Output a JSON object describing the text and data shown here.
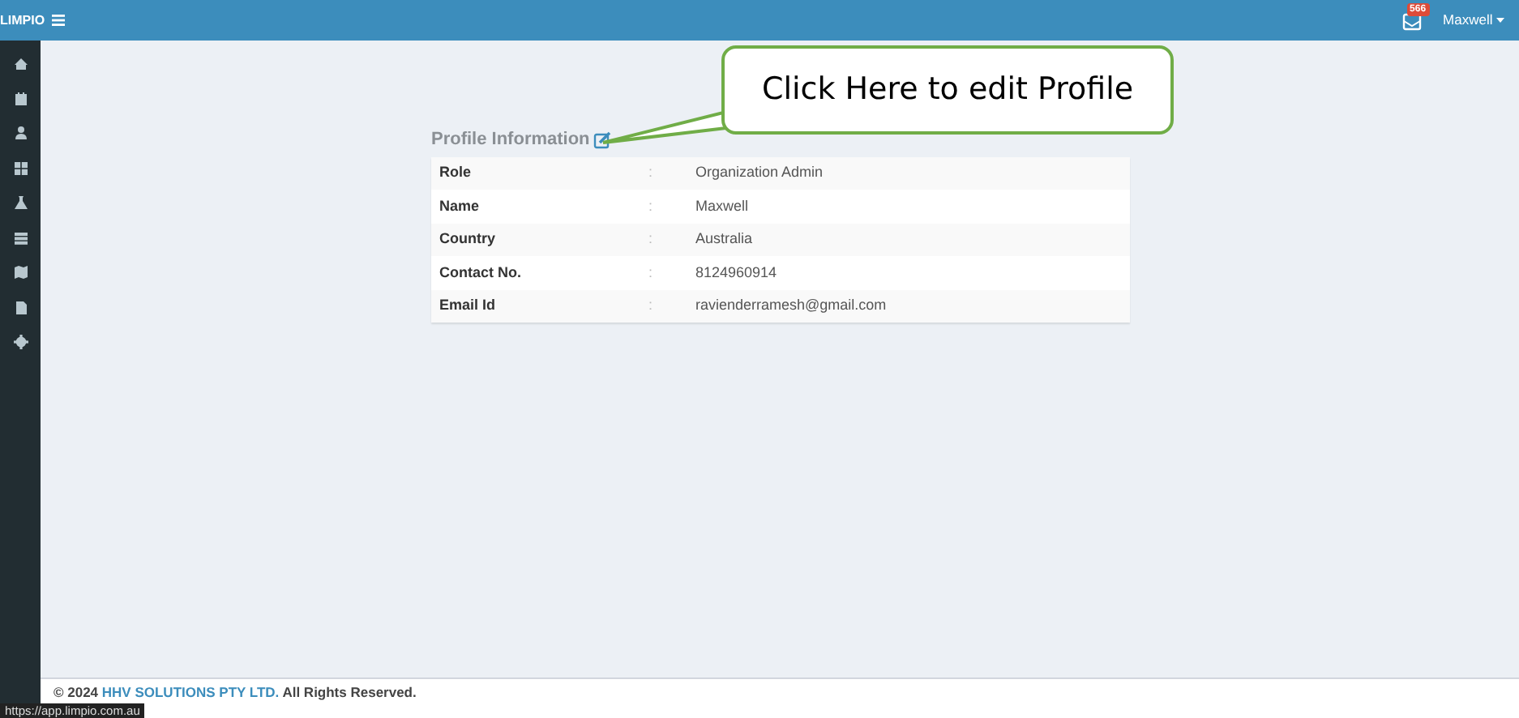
{
  "navbar": {
    "brand": "LIMPIO",
    "notification_count": "566",
    "user": "Maxwell"
  },
  "sidebar": {
    "items": [
      {
        "kind": "home"
      },
      {
        "kind": "calendar"
      },
      {
        "kind": "user"
      },
      {
        "kind": "grid"
      },
      {
        "kind": "flask"
      },
      {
        "kind": "list"
      },
      {
        "kind": "map"
      },
      {
        "kind": "file"
      },
      {
        "kind": "gear"
      }
    ]
  },
  "profile": {
    "title": "Profile Information",
    "separator": ":",
    "rows": [
      {
        "label": "Role",
        "value": "Organization Admin"
      },
      {
        "label": "Name",
        "value": "Maxwell"
      },
      {
        "label": "Country",
        "value": "Australia"
      },
      {
        "label": "Contact No.",
        "value": "8124960914"
      },
      {
        "label": "Email Id",
        "value": "ravienderramesh@gmail.com"
      }
    ]
  },
  "callout": {
    "text": "Click Here to edit Profile"
  },
  "footer": {
    "prefix": "© 2024",
    "company": "HHV SOLUTIONS PTY LTD.",
    "suffix": "All Rights Reserved."
  },
  "status_url": "https://app.limpio.com.au"
}
